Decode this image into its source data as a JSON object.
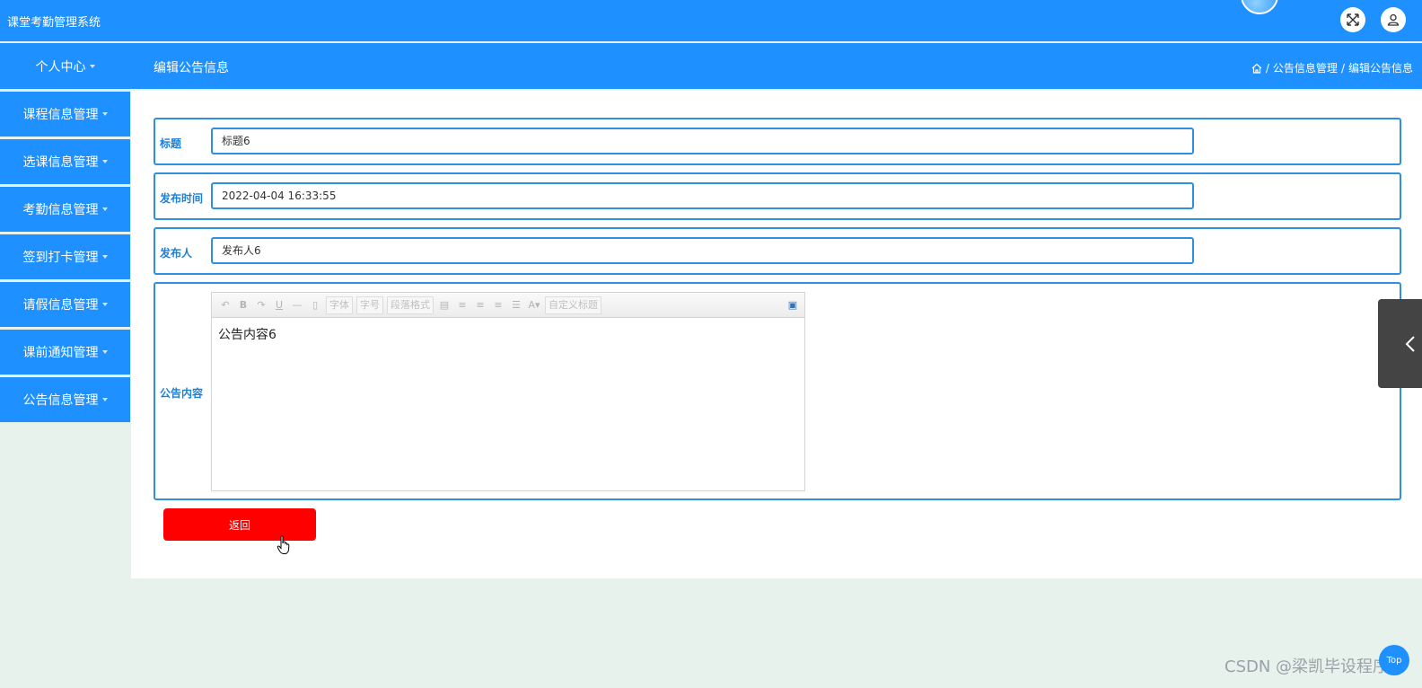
{
  "app": {
    "title": "课堂考勤管理系统"
  },
  "icons": {
    "fullscreen": "expand-arrows-icon",
    "user": "user-icon",
    "home": "home-icon",
    "side_tab": "chevron-left-icon"
  },
  "colors": {
    "primary": "#1e90ff",
    "border": "#2f8fe0",
    "back_button": "#ff0000",
    "page_background": "#e8f2ec"
  },
  "nav": {
    "personal_center": "个人中心",
    "page_title": "编辑公告信息",
    "breadcrumb": [
      "公告信息管理",
      "编辑公告信息"
    ],
    "breadcrumb_separator": "/"
  },
  "sidebar": {
    "items": [
      {
        "label": "课程信息管理"
      },
      {
        "label": "选课信息管理"
      },
      {
        "label": "考勤信息管理"
      },
      {
        "label": "签到打卡管理"
      },
      {
        "label": "请假信息管理"
      },
      {
        "label": "课前通知管理"
      },
      {
        "label": "公告信息管理"
      }
    ]
  },
  "form": {
    "title": {
      "label": "标题",
      "value": "标题6"
    },
    "publish_time": {
      "label": "发布时间",
      "value": "2022-04-04 16:33:55"
    },
    "publisher": {
      "label": "发布人",
      "value": "发布人6"
    },
    "content": {
      "label": "公告内容",
      "value": "公告内容6"
    }
  },
  "editor": {
    "font_family": "字体",
    "font_size": "字号",
    "paragraph": "段落格式",
    "custom_title": "自定义标题"
  },
  "actions": {
    "back": "返回"
  },
  "footer": {
    "watermark": "CSDN @梁凯毕设程序",
    "top": "Top"
  }
}
